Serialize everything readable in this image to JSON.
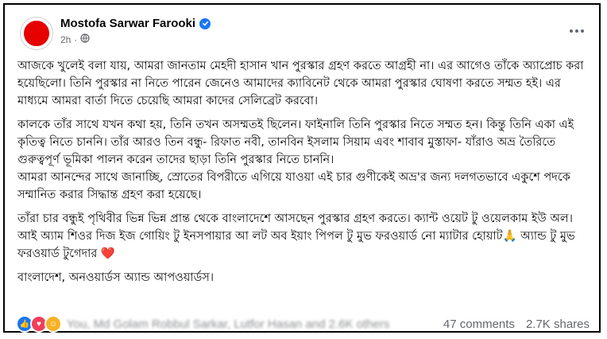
{
  "post": {
    "author": "Mostofa Sarwar Farooki",
    "time": "2h",
    "accent_color": "#1877f2",
    "avatar_color": "#e60000",
    "paragraphs": [
      "আজকে খুলেই বলা যায়, আমরা জানতাম মেহদী হাসান খান পুরস্কার গ্রহণ করতে আগ্রহী না। এর আগেও তাঁকে অ্যাপ্রোচ করা হয়েছিলো। তিনি পুরস্কার না নিতে পারেন জেনেও আমাদের ক্যাবিনেট থেকে আমরা পুরস্কার ঘোষণা করতে সম্মত হই। এর মাধ্যমে আমরা বার্তা দিতে চেয়েছি আমরা কাদের সেলিব্রেট করবো।",
      "কালকে তাঁর সাথে যখন কথা হয়, তিনি তখন অসম্মতই ছিলেন। ফাইনালি তিনি পুরস্কার নিতে সম্মত হন। কিন্তু তিনি একা এই কৃতিত্ব নিতে চাননি। তাঁর আরও তিন বন্ধু- রিফাত নবী, তানবিন ইসলাম সিয়াম এবং শাবাব মুস্তাফা- যাঁরাও অভ্র তৈরিতে গুরুত্বপূর্ণ ভূমিকা পালন করেন তাদের ছাড়া তিনি পুরস্কার নিতে চাননি।\nআমরা আনন্দের সাথে জানাচ্ছি, স্রোতের বিপরীতে এগিয়ে যাওয়া এই চার গুণীকেই অভ্র'র জন্য দলগতভাবে একুশে পদকে সম্মানিত করার সিদ্ধান্ত গ্রহণ করা হয়েছে।",
      "তাঁরা চার বন্ধুই পৃথিবীর ভিন্ন ভিন্ন প্রান্ত থেকে বাংলাদেশে আসছেন পুরস্কার গ্রহণ করতে। ক্যান্ট ওয়েট টু ওয়েলকাম ইউ অল। আই অ্যাম শিওর দিজ ইজ গোয়িং টু ইনসপায়ার আ লট অব ইয়াং পিপল টু মুভ ফরওয়ার্ড নো ম্যাটার হোয়াট🙏 অ্যান্ড টু মুভ ফরওয়ার্ড টুগেদার ❤️",
      "বাংলাদেশ, অনওয়ার্ডস অ্যান্ড আপওয়ার্ডস।"
    ]
  },
  "footer": {
    "reactors": "You, Md Golam Robbul Sarkar, Lutfor Hasan and 2.6K others",
    "comments": "47 comments",
    "shares": "2.7K shares"
  }
}
